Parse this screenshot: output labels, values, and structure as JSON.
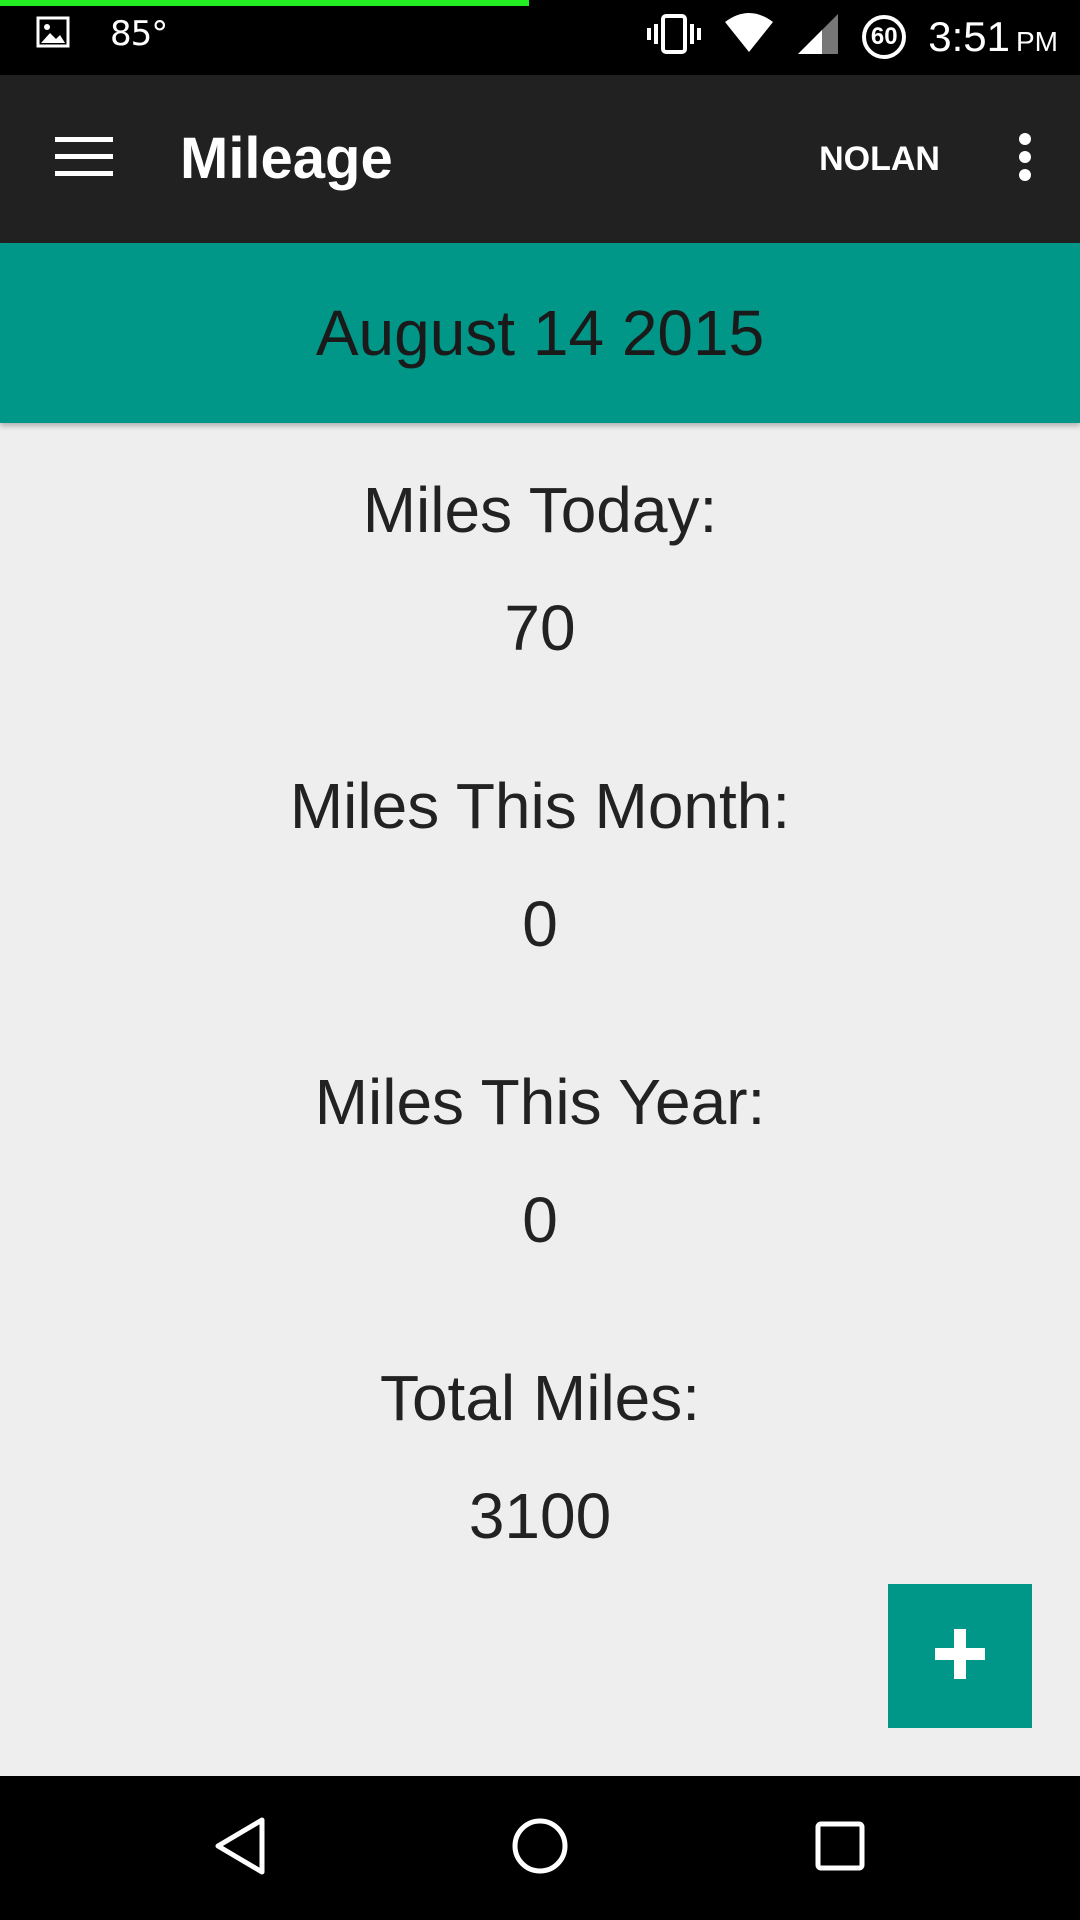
{
  "status_bar": {
    "temperature": "85°",
    "time": "3:51",
    "ampm": "PM",
    "speed_badge": "60",
    "icons": [
      "image-icon",
      "vibrate-icon",
      "wifi-icon",
      "signal-icon"
    ],
    "progress_fraction": 0.49,
    "progress_color": "#22ee22"
  },
  "app_bar": {
    "title": "Mileage",
    "user_action": "NOLAN",
    "icons": [
      "hamburger-menu-icon",
      "overflow-menu-icon"
    ]
  },
  "date_banner": {
    "date": "August 14 2015"
  },
  "stats": {
    "today": {
      "label": "Miles Today:",
      "value": "70"
    },
    "month": {
      "label": "Miles This Month:",
      "value": "0"
    },
    "year": {
      "label": "Miles This Year:",
      "value": "0"
    },
    "total": {
      "label": "Total Miles:",
      "value": "3100"
    }
  },
  "fab": {
    "icon": "plus-icon"
  },
  "nav_bar": {
    "icons": [
      "back-icon",
      "home-icon",
      "recents-icon"
    ]
  },
  "colors": {
    "accent": "#009688",
    "app_bar": "#212121",
    "background": "#eeeeee"
  }
}
